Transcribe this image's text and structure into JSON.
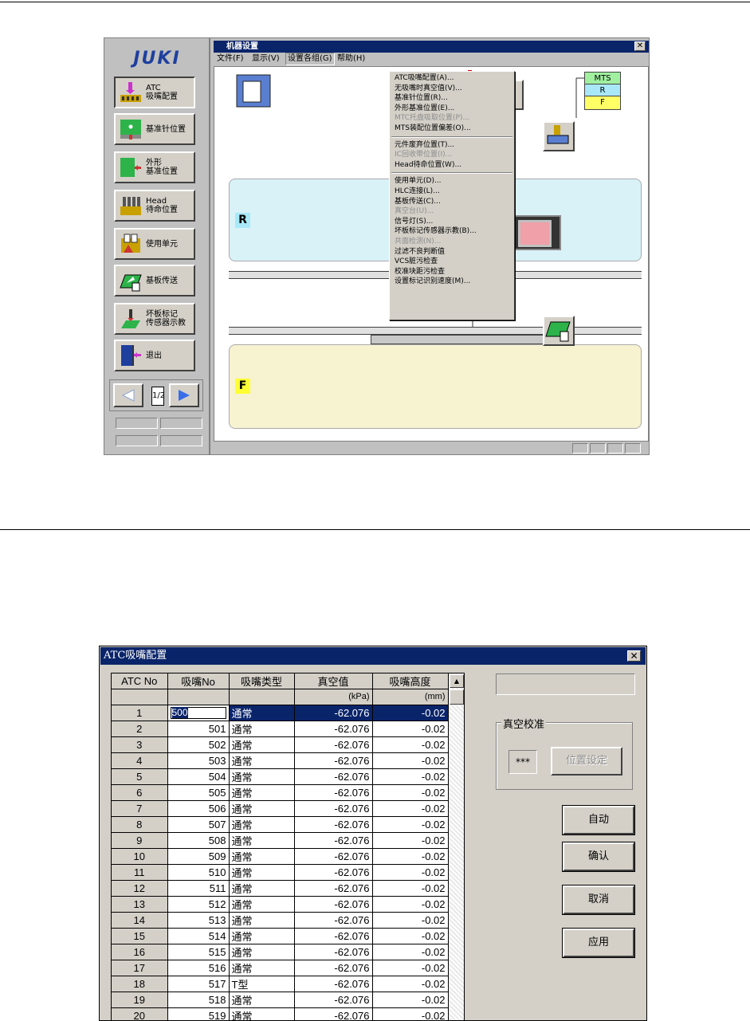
{
  "machine_window": {
    "title": "机器设置",
    "menubar": [
      "文件(F)",
      "显示(V)",
      "设置各组(G)",
      "帮助(H)"
    ],
    "open_menu": [
      {
        "label": "ATC吸嘴配置(A)...",
        "enabled": true
      },
      {
        "label": "无吸嘴时真空值(V)...",
        "enabled": true
      },
      {
        "label": "基准针位置(R)...",
        "enabled": true
      },
      {
        "label": "外形基准位置(E)...",
        "enabled": true
      },
      {
        "label": "MTC托盘吸取位置(P)...",
        "enabled": false
      },
      {
        "label": "MTS装配位置偏差(O)...",
        "enabled": true
      },
      {
        "separator": true
      },
      {
        "label": "元件废弃位置(T)...",
        "enabled": true
      },
      {
        "label": "IC回收带位置(I)...",
        "enabled": false
      },
      {
        "label": "Head待命位置(W)...",
        "enabled": true
      },
      {
        "separator": true
      },
      {
        "label": "使用单元(D)...",
        "enabled": true
      },
      {
        "label": "HLC连接(L)...",
        "enabled": true
      },
      {
        "label": "基板传送(C)...",
        "enabled": true
      },
      {
        "label": "真空台(U)...",
        "enabled": false
      },
      {
        "label": "信号灯(S)...",
        "enabled": true
      },
      {
        "label": "坏板标记传感器示教(B)...",
        "enabled": true
      },
      {
        "label": "共面检测(N)...",
        "enabled": false
      },
      {
        "label": "过滤不良判断值",
        "enabled": true
      },
      {
        "label": "VCS脏污检查",
        "enabled": true
      },
      {
        "label": "校准块距污检查",
        "enabled": true
      },
      {
        "label": "设置标记识别速度(M)...",
        "enabled": true
      }
    ],
    "zone_r": "R",
    "zone_f": "F",
    "mts": {
      "label": "MTS",
      "r": "R",
      "f": "F"
    }
  },
  "side_panel": {
    "logo": "JUKI",
    "buttons": [
      {
        "label": "ATC\n吸嘴配置",
        "icon": "atc-nozzle-icon"
      },
      {
        "label": "基准针位置",
        "icon": "reference-pin-icon"
      },
      {
        "label": "外形\n基准位置",
        "icon": "outline-reference-icon"
      },
      {
        "label": "Head\n待命位置",
        "icon": "head-standby-icon"
      },
      {
        "label": "使用单元",
        "icon": "unit-icon"
      },
      {
        "label": "基板传送",
        "icon": "board-transfer-icon"
      },
      {
        "label": "坏板标记\n传感器示教",
        "icon": "bad-mark-sensor-icon"
      },
      {
        "label": "退出",
        "icon": "exit-door-icon"
      }
    ],
    "page": "1/2"
  },
  "atc_dialog": {
    "title": "ATC吸嘴配置",
    "columns": [
      "ATC No",
      "吸嘴No",
      "吸嘴类型",
      "真空值",
      "吸嘴高度"
    ],
    "units": [
      "",
      "",
      "",
      "(kPa)",
      "(mm)"
    ],
    "editing_value": "500",
    "rows": [
      [
        "1",
        "500",
        "通常",
        "-62.076",
        "-0.02"
      ],
      [
        "2",
        "501",
        "通常",
        "-62.076",
        "-0.02"
      ],
      [
        "3",
        "502",
        "通常",
        "-62.076",
        "-0.02"
      ],
      [
        "4",
        "503",
        "通常",
        "-62.076",
        "-0.02"
      ],
      [
        "5",
        "504",
        "通常",
        "-62.076",
        "-0.02"
      ],
      [
        "6",
        "505",
        "通常",
        "-62.076",
        "-0.02"
      ],
      [
        "7",
        "506",
        "通常",
        "-62.076",
        "-0.02"
      ],
      [
        "8",
        "507",
        "通常",
        "-62.076",
        "-0.02"
      ],
      [
        "9",
        "508",
        "通常",
        "-62.076",
        "-0.02"
      ],
      [
        "10",
        "509",
        "通常",
        "-62.076",
        "-0.02"
      ],
      [
        "11",
        "510",
        "通常",
        "-62.076",
        "-0.02"
      ],
      [
        "12",
        "511",
        "通常",
        "-62.076",
        "-0.02"
      ],
      [
        "13",
        "512",
        "通常",
        "-62.076",
        "-0.02"
      ],
      [
        "14",
        "513",
        "通常",
        "-62.076",
        "-0.02"
      ],
      [
        "15",
        "514",
        "通常",
        "-62.076",
        "-0.02"
      ],
      [
        "16",
        "515",
        "通常",
        "-62.076",
        "-0.02"
      ],
      [
        "17",
        "516",
        "通常",
        "-62.076",
        "-0.02"
      ],
      [
        "18",
        "517",
        "T型",
        "-62.076",
        "-0.02"
      ],
      [
        "19",
        "518",
        "通常",
        "-62.076",
        "-0.02"
      ],
      [
        "20",
        "519",
        "通常",
        "-62.076",
        "-0.02"
      ]
    ],
    "vacuum_group": "真空校准",
    "vacuum_value": "***",
    "position_button": "位置设定",
    "auto_button": "自动",
    "confirm_button": "确认",
    "cancel_button": "取消",
    "apply_button": "应用"
  },
  "colors": {
    "title_bar": "#0a246a",
    "zone_r": "#d9f2f7",
    "zone_f": "#f7f2d0",
    "label_r": "#a8e8f8",
    "label_f": "#ffff33",
    "logo": "#1e3f9e"
  }
}
